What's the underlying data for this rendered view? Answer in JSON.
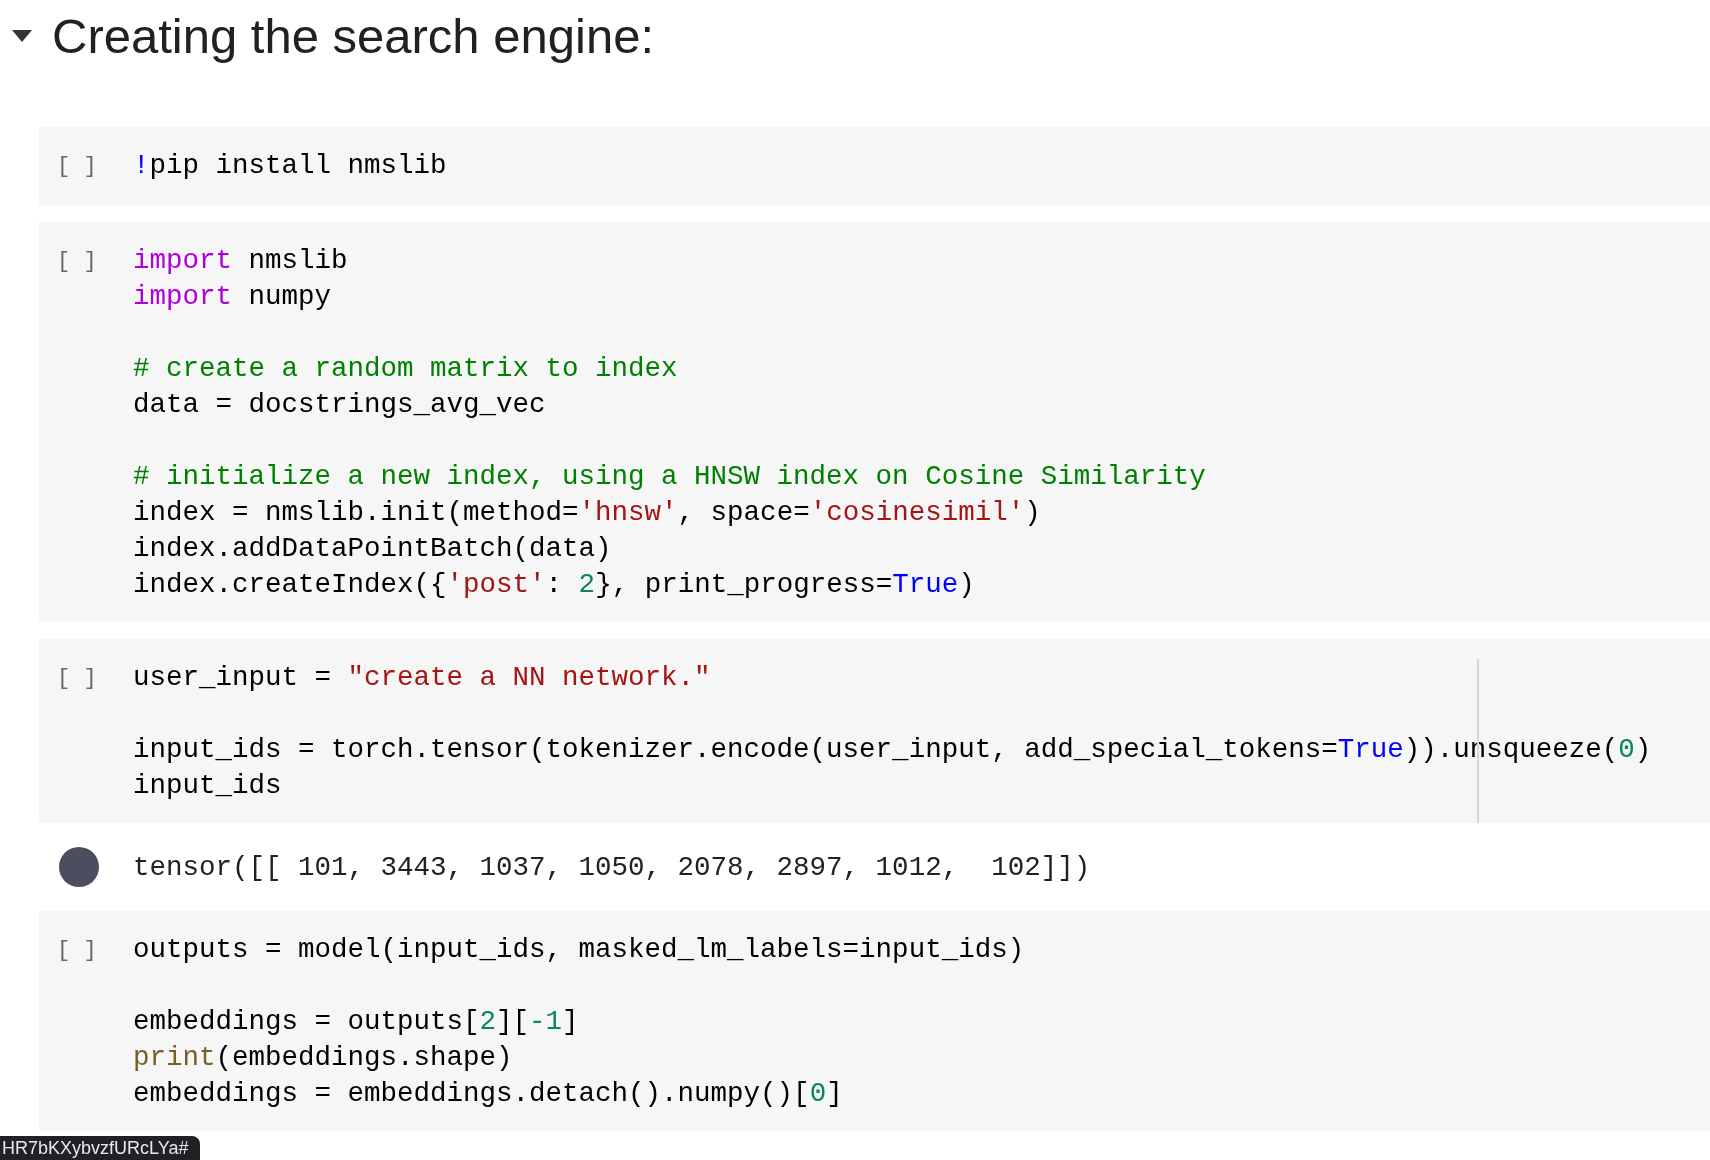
{
  "section": {
    "title": "Creating the search engine:",
    "expanded": true
  },
  "cells": [
    {
      "kind": "code",
      "prompt": "[ ]",
      "ruler": false,
      "blocks": [
        [
          [
            {
              "text": "!",
              "kind": "bang"
            },
            {
              "text": "pip install nmslib",
              "kind": "plain"
            }
          ]
        ]
      ]
    },
    {
      "kind": "code",
      "prompt": "[ ]",
      "ruler": false,
      "blocks": [
        [
          [
            {
              "text": "import",
              "kind": "keyword"
            },
            {
              "text": " nmslib",
              "kind": "plain"
            }
          ],
          [
            {
              "text": "import",
              "kind": "keyword"
            },
            {
              "text": " numpy",
              "kind": "plain"
            }
          ]
        ],
        [
          [
            {
              "text": "# create a random matrix to index",
              "kind": "comment"
            }
          ],
          [
            {
              "text": "data = docstrings_avg_vec",
              "kind": "plain"
            }
          ]
        ],
        [
          [
            {
              "text": "# initialize a new index, using a HNSW index on Cosine Similarity",
              "kind": "comment"
            }
          ],
          [
            {
              "text": "index = nmslib.init(method=",
              "kind": "plain"
            },
            {
              "text": "'hnsw'",
              "kind": "string"
            },
            {
              "text": ", space=",
              "kind": "plain"
            },
            {
              "text": "'cosinesimil'",
              "kind": "string"
            },
            {
              "text": ")",
              "kind": "plain"
            }
          ],
          [
            {
              "text": "index.addDataPointBatch(data)",
              "kind": "plain"
            }
          ],
          [
            {
              "text": "index.createIndex({",
              "kind": "plain"
            },
            {
              "text": "'post'",
              "kind": "string"
            },
            {
              "text": ": ",
              "kind": "plain"
            },
            {
              "text": "2",
              "kind": "number"
            },
            {
              "text": "}, print_progress=",
              "kind": "plain"
            },
            {
              "text": "True",
              "kind": "constant"
            },
            {
              "text": ")",
              "kind": "plain"
            }
          ]
        ]
      ]
    },
    {
      "kind": "code",
      "prompt": "[ ]",
      "ruler": true,
      "blocks": [
        [
          [
            {
              "text": "user_input = ",
              "kind": "plain"
            },
            {
              "text": "\"create a NN network.\"",
              "kind": "string"
            }
          ]
        ],
        [
          [
            {
              "text": "input_ids = torch.tensor(tokenizer.encode(user_input, add_special_tokens=",
              "kind": "plain"
            },
            {
              "text": "True",
              "kind": "constant"
            },
            {
              "text": ")).unsqueeze(",
              "kind": "plain"
            },
            {
              "text": "0",
              "kind": "number"
            },
            {
              "text": ")",
              "kind": "plain"
            }
          ],
          [
            {
              "text": "input_ids",
              "kind": "plain"
            }
          ]
        ]
      ]
    },
    {
      "kind": "output",
      "text": "tensor([[ 101, 3443, 1037, 1050, 2078, 2897, 1012,  102]])"
    },
    {
      "kind": "code",
      "prompt": "[ ]",
      "ruler": false,
      "blocks": [
        [
          [
            {
              "text": "outputs = model(input_ids, masked_lm_labels=input_ids)",
              "kind": "plain"
            }
          ]
        ],
        [
          [
            {
              "text": "embeddings = outputs[",
              "kind": "plain"
            },
            {
              "text": "2",
              "kind": "number"
            },
            {
              "text": "][",
              "kind": "plain"
            },
            {
              "text": "-1",
              "kind": "number"
            },
            {
              "text": "]",
              "kind": "plain"
            }
          ],
          [
            {
              "text": "print",
              "kind": "builtin"
            },
            {
              "text": "(embeddings.shape)",
              "kind": "plain"
            }
          ],
          [
            {
              "text": "embeddings = embeddings.detach().numpy()[",
              "kind": "plain"
            },
            {
              "text": "0",
              "kind": "number"
            },
            {
              "text": "]",
              "kind": "plain"
            }
          ]
        ]
      ]
    }
  ],
  "status_link": "HR7bKXybvzfURcLYa#"
}
